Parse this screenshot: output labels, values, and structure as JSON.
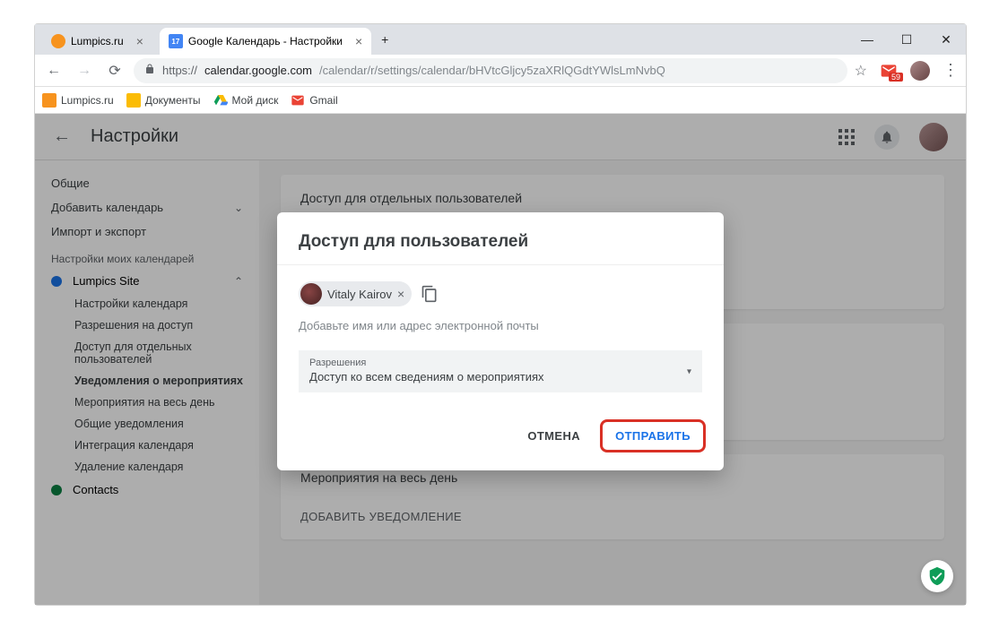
{
  "tabs": [
    {
      "label": "Lumpics.ru",
      "favicon": "#f7931e"
    },
    {
      "label": "Google Календарь - Настройки",
      "favicon": "#4285f4"
    }
  ],
  "url": {
    "protocol": "https://",
    "domain": "calendar.google.com",
    "path": "/calendar/r/settings/calendar/bHVtcGljcy5zaXRlQGdtYWlsLmNvbQ"
  },
  "gmail_badge": "59",
  "bookmarks": [
    {
      "label": "Lumpics.ru",
      "color": "#f7931e"
    },
    {
      "label": "Документы",
      "color": "#fbbc04"
    },
    {
      "label": "Мой диск",
      "color": "#0f9d58"
    },
    {
      "label": "Gmail",
      "color": "#ea4335"
    }
  ],
  "settings_title": "Настройки",
  "sidebar": {
    "items": [
      {
        "label": "Общие"
      },
      {
        "label": "Добавить календарь"
      },
      {
        "label": "Импорт и экспорт"
      }
    ],
    "section_label": "Настройки моих календарей",
    "calendars": [
      {
        "label": "Lumpics Site",
        "color": "#1a73e8",
        "expanded": true
      },
      {
        "label": "Contacts",
        "color": "#0b8043",
        "expanded": false
      }
    ],
    "subitems": [
      {
        "label": "Настройки календаря"
      },
      {
        "label": "Разрешения на доступ"
      },
      {
        "label": "Доступ для отдельных пользователей"
      },
      {
        "label": "Уведомления о мероприятиях",
        "active": true
      },
      {
        "label": "Мероприятия на весь день"
      },
      {
        "label": "Общие уведомления"
      },
      {
        "label": "Интеграция календаря"
      },
      {
        "label": "Удаление календаря"
      }
    ]
  },
  "cards": {
    "access_title": "Доступ для отдельных пользователей",
    "allday_title": "Мероприятия на весь день",
    "add_notification": "ДОБАВИТЬ УВЕДОМЛЕНИЕ"
  },
  "dialog": {
    "title": "Доступ для пользователей",
    "chip_name": "Vitaly Kairov",
    "input_hint": "Добавьте имя или адрес электронной почты",
    "perm_label": "Разрешения",
    "perm_value": "Доступ ко всем сведениям о мероприятиях",
    "cancel": "ОТМЕНА",
    "send": "ОТПРАВИТЬ"
  }
}
